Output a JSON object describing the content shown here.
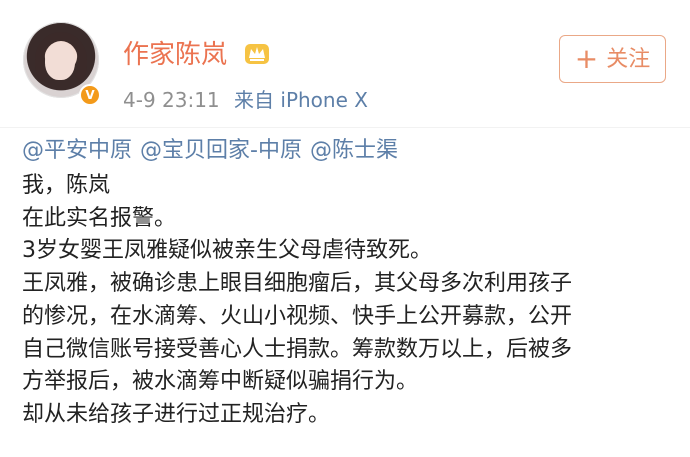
{
  "header": {
    "author_name": "作家陈岚",
    "verified_badge": "V",
    "timestamp": "4-9 23:11",
    "source_prefix": "来自",
    "source_device": "iPhone X",
    "follow_label": "关注",
    "follow_plus": "+"
  },
  "mentions": [
    "@平安中原",
    "@宝贝回家-中原",
    "@陈士渠"
  ],
  "body_lines": [
    "我，陈岚",
    "在此实名报警。",
    "3岁女婴王凤雅疑似被亲生父母虐待致死。",
    "王凤雅，被确诊患上眼目细胞瘤后，其父母多次利用孩子",
    "的惨况，在水滴筹、火山小视频、快手上公开募款，公开",
    "自己微信账号接受善心人士捐款。筹款数万以上，后被多",
    "方举报后，被水滴筹中断疑似骗捐行为。",
    "却从未给孩子进行过正规治疗。"
  ],
  "colors": {
    "name": "#eb7350",
    "link": "#5d7fa8",
    "meta": "#8f8f8f",
    "text": "#222222",
    "badge": "#f39a1a"
  },
  "icons": [
    "crown-icon",
    "plus-icon",
    "avatar"
  ]
}
